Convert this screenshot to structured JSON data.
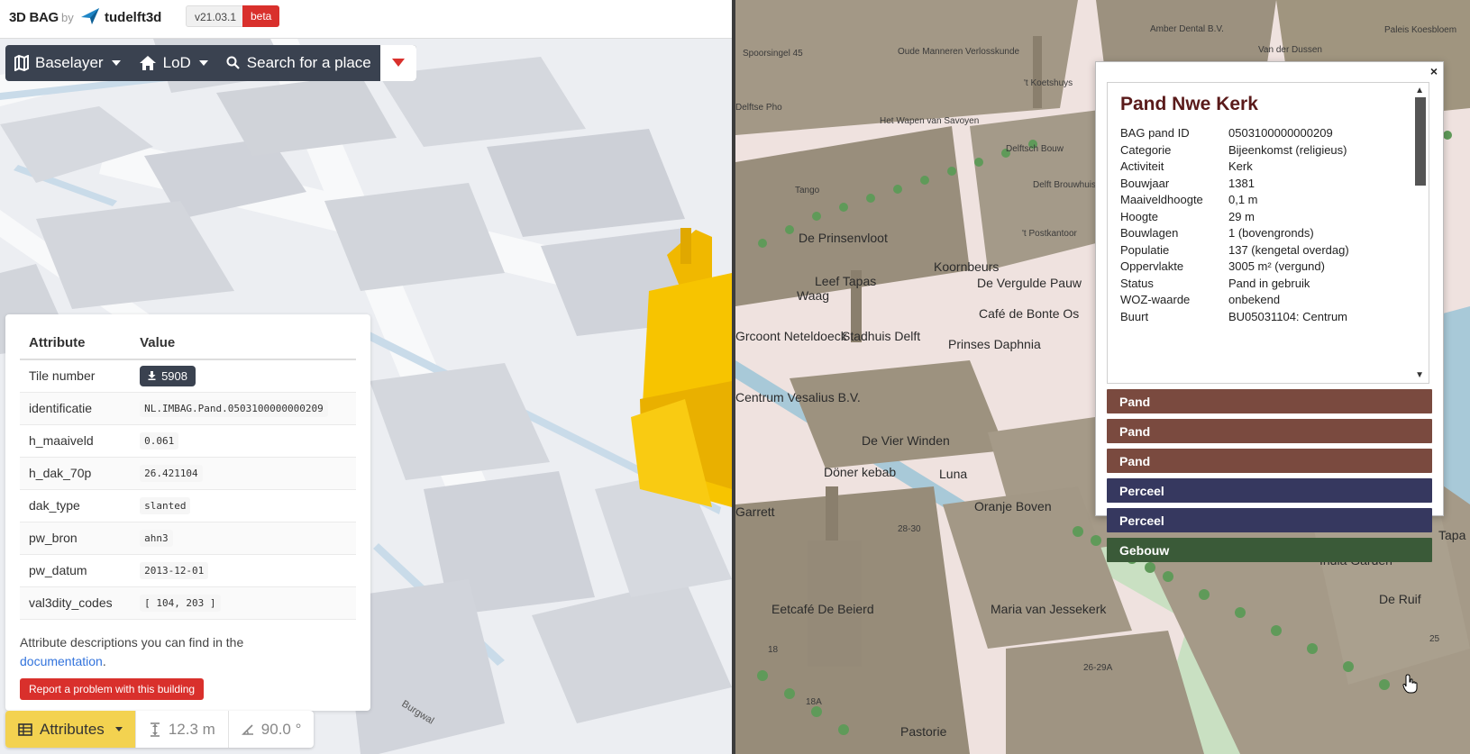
{
  "header": {
    "brand": "3D BAG",
    "by": "by",
    "org": "tudelft3d",
    "version": "v21.03.1",
    "badge": "beta"
  },
  "toolbar": {
    "baselayer_label": "Baselayer",
    "lod_label": "LoD",
    "search_label": "Search for a place"
  },
  "attributes": {
    "col_attribute": "Attribute",
    "col_value": "Value",
    "tile_key": "Tile number",
    "tile_value": "5908",
    "rows": [
      {
        "key": "identificatie",
        "value": "NL.IMBAG.Pand.0503100000000209"
      },
      {
        "key": "h_maaiveld",
        "value": "0.061"
      },
      {
        "key": "h_dak_70p",
        "value": "26.421104"
      },
      {
        "key": "dak_type",
        "value": "slanted"
      },
      {
        "key": "pw_bron",
        "value": "ahn3"
      },
      {
        "key": "pw_datum",
        "value": "2013-12-01"
      },
      {
        "key": "val3dity_codes",
        "value": "[ 104, 203 ]"
      }
    ],
    "note": "Attribute descriptions you can find in the",
    "link": "documentation",
    "link_suffix": ".",
    "report": "Report a problem with this building"
  },
  "bottombar": {
    "attributes_label": "Attributes",
    "height_value": "12.3 m",
    "angle_value": "90.0 °"
  },
  "left_map_labels": [
    "Burgwal"
  ],
  "popup": {
    "close": "×",
    "title": "Pand Nwe Kerk",
    "rows": [
      {
        "k": "BAG pand ID",
        "v": "0503100000000209"
      },
      {
        "k": "Categorie",
        "v": "Bijeenkomst (religieus)"
      },
      {
        "k": "Activiteit",
        "v": "Kerk"
      },
      {
        "k": "Bouwjaar",
        "v": "1381"
      },
      {
        "k": "Maaiveldhoogte",
        "v": "0,1 m"
      },
      {
        "k": "Hoogte",
        "v": "29 m"
      },
      {
        "k": "Bouwlagen",
        "v": "1 (bovengronds)"
      },
      {
        "k": "Populatie",
        "v": "137 (kengetal overdag)"
      },
      {
        "k": "Oppervlakte",
        "v": "3005 m² (vergund)"
      },
      {
        "k": "Status",
        "v": "Pand in gebruik"
      },
      {
        "k": "WOZ-waarde",
        "v": "onbekend"
      },
      {
        "k": "Buurt",
        "v": "BU05031104: Centrum"
      }
    ],
    "layers": [
      {
        "label": "Pand",
        "color": "#7a4a3f"
      },
      {
        "label": "Pand",
        "color": "#7a4a3f"
      },
      {
        "label": "Pand",
        "color": "#7a4a3f"
      },
      {
        "label": "Perceel",
        "color": "#36385f"
      },
      {
        "label": "Perceel",
        "color": "#36385f"
      },
      {
        "label": "Gebouw",
        "color": "#3a5a38"
      }
    ]
  },
  "right_map_labels": {
    "large": [
      "De Prinsenvloot",
      "Koornbeurs",
      "De Vergulde Pauw",
      "Café de Bonte Os",
      "Leef Tapas",
      "Waag",
      "Stadhuis Delft",
      "Prinses Daphnia",
      "Grcoont Neteldoeck",
      "Centrum Vesalius B.V.",
      "De Vier Winden",
      "Döner kebab",
      "Luna",
      "Oranje Boven",
      "Garrett",
      "Eetcafé De Beierd",
      "Maria van Jessekerk",
      "India Garden",
      "De Ruif",
      "Tapa",
      "Pastorie"
    ],
    "small": [
      "Spoorsingel 45",
      "Oude Manneren Verlosskunde",
      "Amber Dental B.V.",
      "Paleis Koesbloem",
      "Van der Dussen",
      "'t Koetshuys",
      "Het Wapen van Savoyen",
      "Delftsch Bouw",
      "Delft Brouwhuis",
      "Tango",
      "Delftse Pho",
      "'t Postkantoor",
      "28-30",
      "26-29A",
      "18A",
      "18",
      "11",
      "25"
    ]
  },
  "colors": {
    "toolbar": "#3a4250",
    "highlight": "#f3d250",
    "danger": "#d9302c",
    "link": "#3273dc",
    "building_right": "#a09585",
    "building_left": "#d2d5db"
  }
}
